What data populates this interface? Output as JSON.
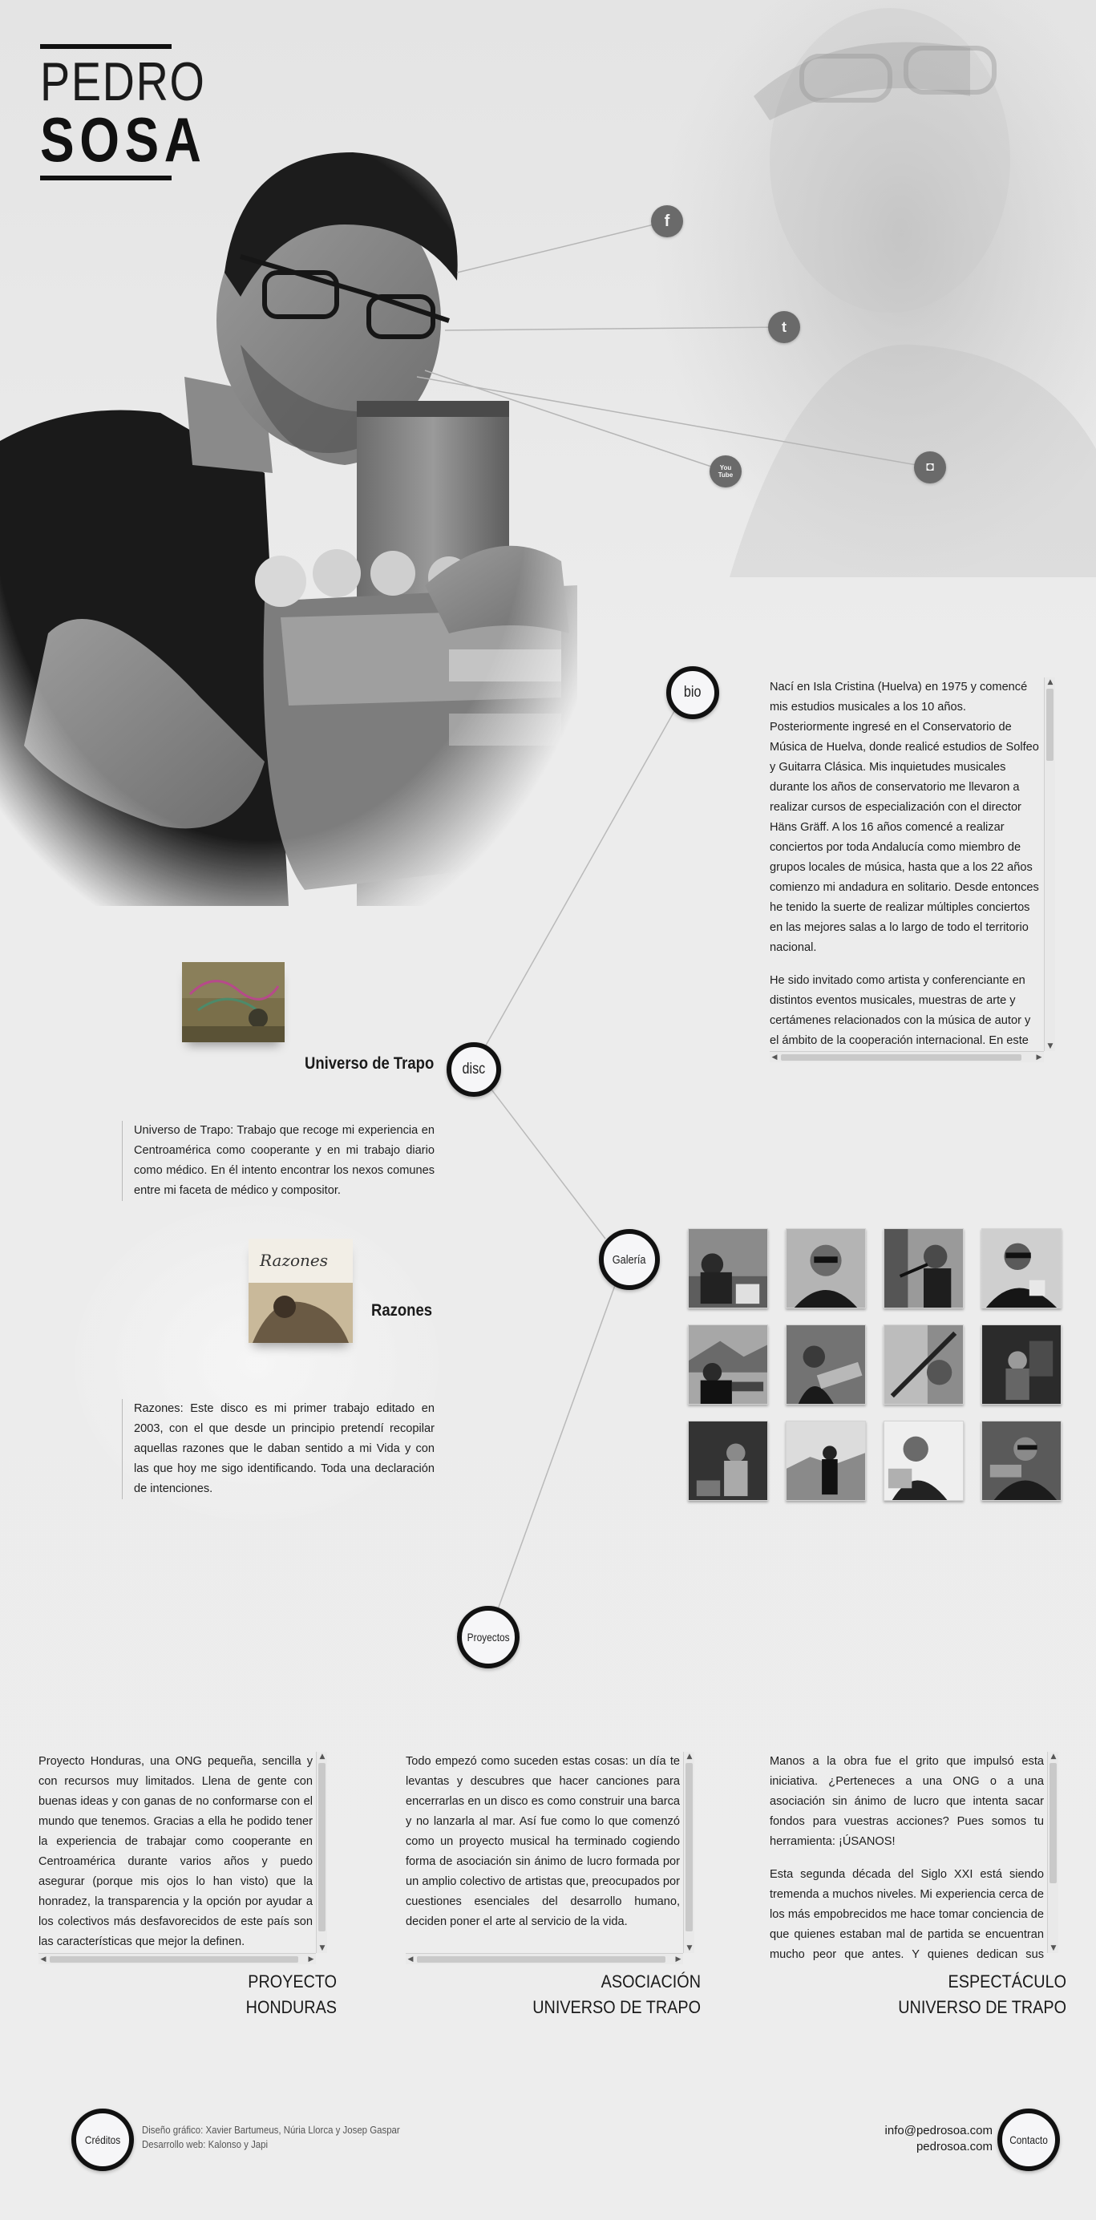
{
  "brand": {
    "line1": "PEDRO",
    "line2": "SOSA"
  },
  "social": [
    {
      "name": "facebook",
      "glyph": "f"
    },
    {
      "name": "twitter",
      "glyph": "t"
    },
    {
      "name": "youtube",
      "glyph": "You Tube"
    },
    {
      "name": "instagram",
      "glyph": "◘"
    }
  ],
  "nodes": {
    "bio": "bio",
    "disc": "disc",
    "galeria": "Galería",
    "proyectos": "Proyectos",
    "creditos": "Créditos",
    "contacto": "Contacto"
  },
  "bio": {
    "paragraphs": [
      "Nací en Isla Cristina (Huelva) en 1975 y comencé mis estudios musicales a los 10 años. Posteriormente ingresé en el Conservatorio de Música de Huelva, donde realicé estudios de Solfeo y Guitarra Clásica. Mis inquietudes musicales durante los años de conservatorio me llevaron a realizar cursos de especialización con el director Häns Gräff. A los 16 años comencé a realizar conciertos por toda Andalucía como miembro de grupos locales de música, hasta que a los 22 años comienzo mi andadura en solitario. Desde entonces he tenido la suerte de realizar múltiples conciertos en las mejores salas a lo largo de todo el territorio nacional.",
      "He sido invitado como artista y conferenciante en distintos eventos musicales, muestras de arte y certámenes relacionados con la música de autor y el ámbito de la cooperación internacional. En este sentido, he compartido escenario y eventos con músicos como"
    ]
  },
  "discs": [
    {
      "title": "Universo de Trapo",
      "description": "Universo de Trapo: Trabajo que recoge mi experiencia en Centroamérica como cooperante y en mi trabajo diario como médico. En él intento encontrar los nexos comunes entre mi faceta de médico y compositor."
    },
    {
      "title": "Razones",
      "description": "Razones: Este disco es mi primer trabajo editado en 2003, con el que desde un principio pretendí recopilar aquellas razones que le daban sentido a mi Vida y con las que hoy me sigo identificando. Toda una declaración de intenciones.",
      "cover_text": "Razones"
    }
  ],
  "projects": [
    {
      "text": "Proyecto Honduras, una ONG pequeña, sencilla y con recursos muy limitados. Llena de gente con buenas ideas y con ganas de no conformarse con el mundo que tenemos. Gracias a ella he podido tener la experiencia de trabajar como cooperante en Centroamérica durante varios años y puedo asegurar (porque mis ojos lo han visto) que la honradez, la transparencia y la opción por ayudar a los colectivos más desfavorecidos de este país son las características que mejor la definen.",
      "title_line1": "PROYECTO",
      "title_line2": "HONDURAS"
    },
    {
      "text": "Todo empezó como suceden estas cosas: un día te levantas y descubres que hacer canciones para encerrarlas en un disco es como construir una barca y no lanzarla al mar. Así fue como lo que comenzó como un proyecto musical ha terminado cogiendo forma de asociación sin ánimo de lucro formada por un amplio colectivo de artistas que, preocupados por cuestiones esenciales del desarrollo humano, deciden poner el arte al servicio de la vida.",
      "title_line1": "ASOCIACIÓN",
      "title_line2": "UNIVERSO DE TRAPO"
    },
    {
      "paragraphs": [
        "Manos a la obra fue el grito que impulsó esta iniciativa. ¿Perteneces a una ONG o a una asociación sin ánimo de lucro que intenta sacar fondos para vuestras acciones? Pues somos tu herramienta: ¡ÚSANOS!",
        "Esta segunda década del Siglo XXI está siendo tremenda a muchos niveles. Mi experiencia cerca de los más empobrecidos me hace tomar conciencia de que quienes estaban mal de partida se encuentran mucho peor que antes. Y quienes dedican sus esfuerzos a"
      ],
      "title_line1": "ESPECTÁCULO",
      "title_line2": "UNIVERSO DE TRAPO"
    }
  ],
  "footer": {
    "credits_line1": "Diseño gráfico: Xavier Bartumeus, Núria Llorca y Josep Gaspar",
    "credits_line2": "Desarrollo web: Kalonso y Japi",
    "email": "info@pedrosoa.com",
    "website": "pedrosoa.com"
  },
  "colors": {
    "background": "#ebebeb",
    "ink": "#111111",
    "social_bg": "#6a6a6a",
    "node_fill": "#f6f6f8"
  }
}
